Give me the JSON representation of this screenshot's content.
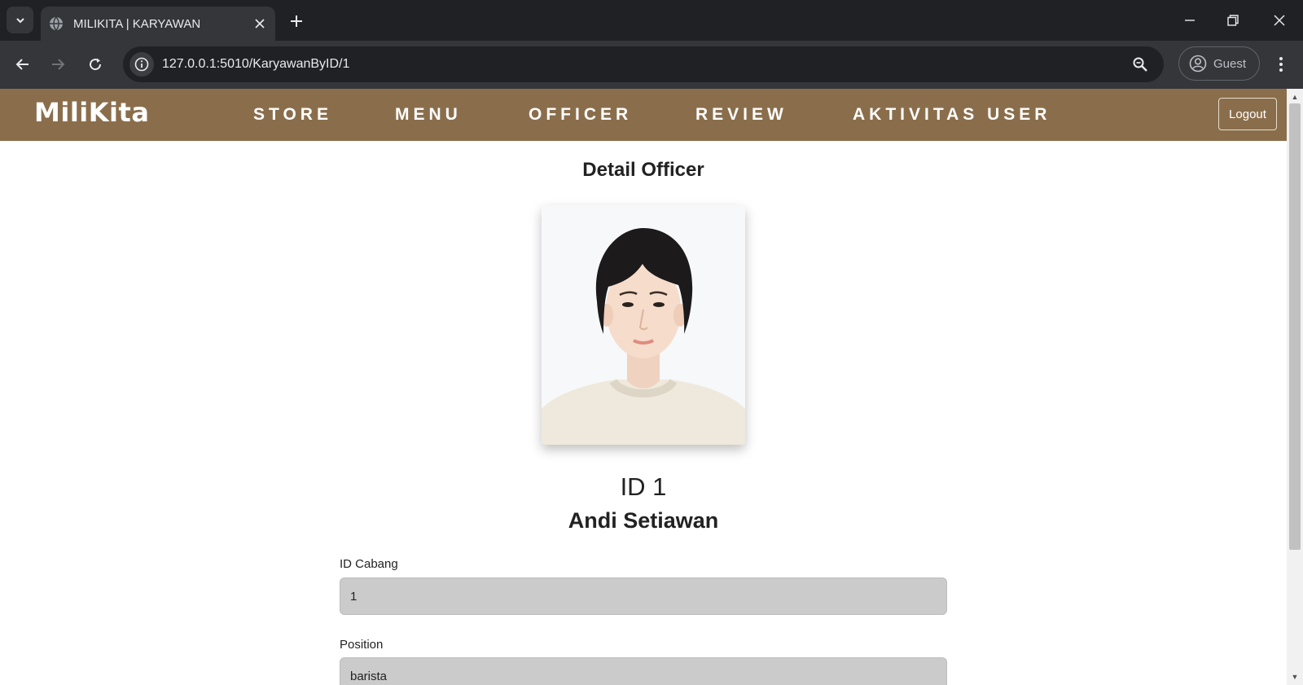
{
  "browser": {
    "tab_title": "MILIKITA | KARYAWAN",
    "url": "127.0.0.1:5010/KaryawanByID/1",
    "profile_label": "Guest"
  },
  "site": {
    "brand": "MiliKita",
    "nav": [
      "STORE",
      "MENU",
      "OFFICER",
      "REVIEW",
      "AKTIVITAS USER"
    ],
    "logout_label": "Logout"
  },
  "detail": {
    "title": "Detail Officer",
    "id_line": "ID 1",
    "name": "Andi Setiawan",
    "fields": [
      {
        "label": "ID Cabang",
        "value": "1"
      },
      {
        "label": "Position",
        "value": "barista"
      }
    ]
  }
}
